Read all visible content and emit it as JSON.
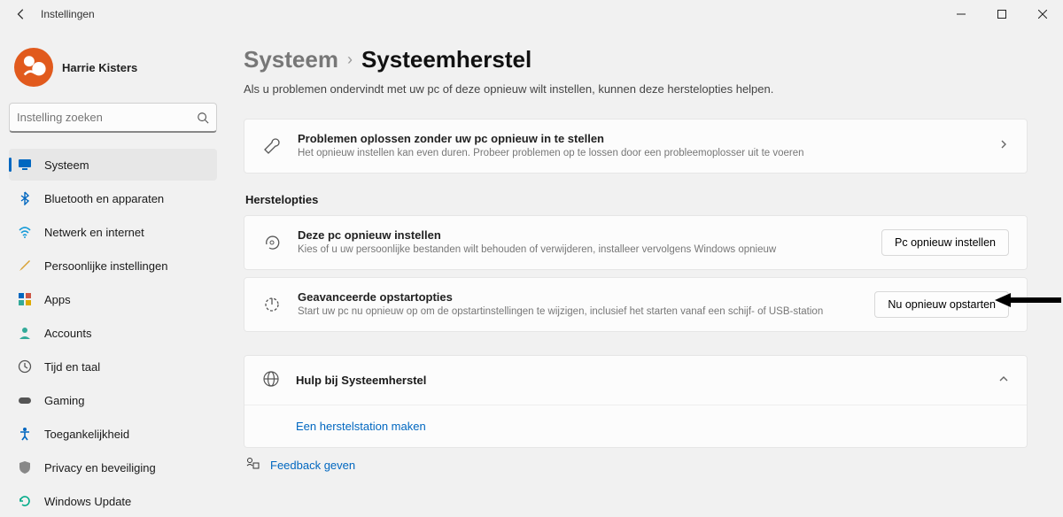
{
  "window": {
    "title": "Instellingen"
  },
  "user": {
    "name": "Harrie Kisters"
  },
  "search": {
    "placeholder": "Instelling zoeken"
  },
  "nav": {
    "items": [
      {
        "label": "Systeem",
        "icon": "monitor",
        "active": true
      },
      {
        "label": "Bluetooth en apparaten",
        "icon": "bluetooth"
      },
      {
        "label": "Netwerk en internet",
        "icon": "wifi"
      },
      {
        "label": "Persoonlijke instellingen",
        "icon": "brush"
      },
      {
        "label": "Apps",
        "icon": "apps"
      },
      {
        "label": "Accounts",
        "icon": "person"
      },
      {
        "label": "Tijd en taal",
        "icon": "clock"
      },
      {
        "label": "Gaming",
        "icon": "game"
      },
      {
        "label": "Toegankelijkheid",
        "icon": "accessibility"
      },
      {
        "label": "Privacy en beveiliging",
        "icon": "shield"
      },
      {
        "label": "Windows Update",
        "icon": "update"
      }
    ]
  },
  "breadcrumb": {
    "parent": "Systeem",
    "current": "Systeemherstel"
  },
  "subtitle": "Als u problemen ondervindt met uw pc of deze opnieuw wilt instellen, kunnen deze herstelopties helpen.",
  "troubleshoot": {
    "title": "Problemen oplossen zonder uw pc opnieuw in te stellen",
    "desc": "Het opnieuw instellen kan even duren. Probeer problemen op te lossen door een probleemoplosser uit te voeren"
  },
  "recovery_section_title": "Herstelopties",
  "reset": {
    "title": "Deze pc opnieuw instellen",
    "desc": "Kies of u uw persoonlijke bestanden wilt behouden of verwijderen, installeer vervolgens Windows opnieuw",
    "button": "Pc opnieuw instellen"
  },
  "advanced": {
    "title": "Geavanceerde opstartopties",
    "desc": "Start uw pc nu opnieuw op om de opstartinstellingen te wijzigen, inclusief het starten vanaf een schijf- of USB-station",
    "button": "Nu opnieuw opstarten"
  },
  "help": {
    "title": "Hulp bij Systeemherstel",
    "link": "Een herstelstation maken"
  },
  "feedback": {
    "label": "Feedback geven"
  }
}
